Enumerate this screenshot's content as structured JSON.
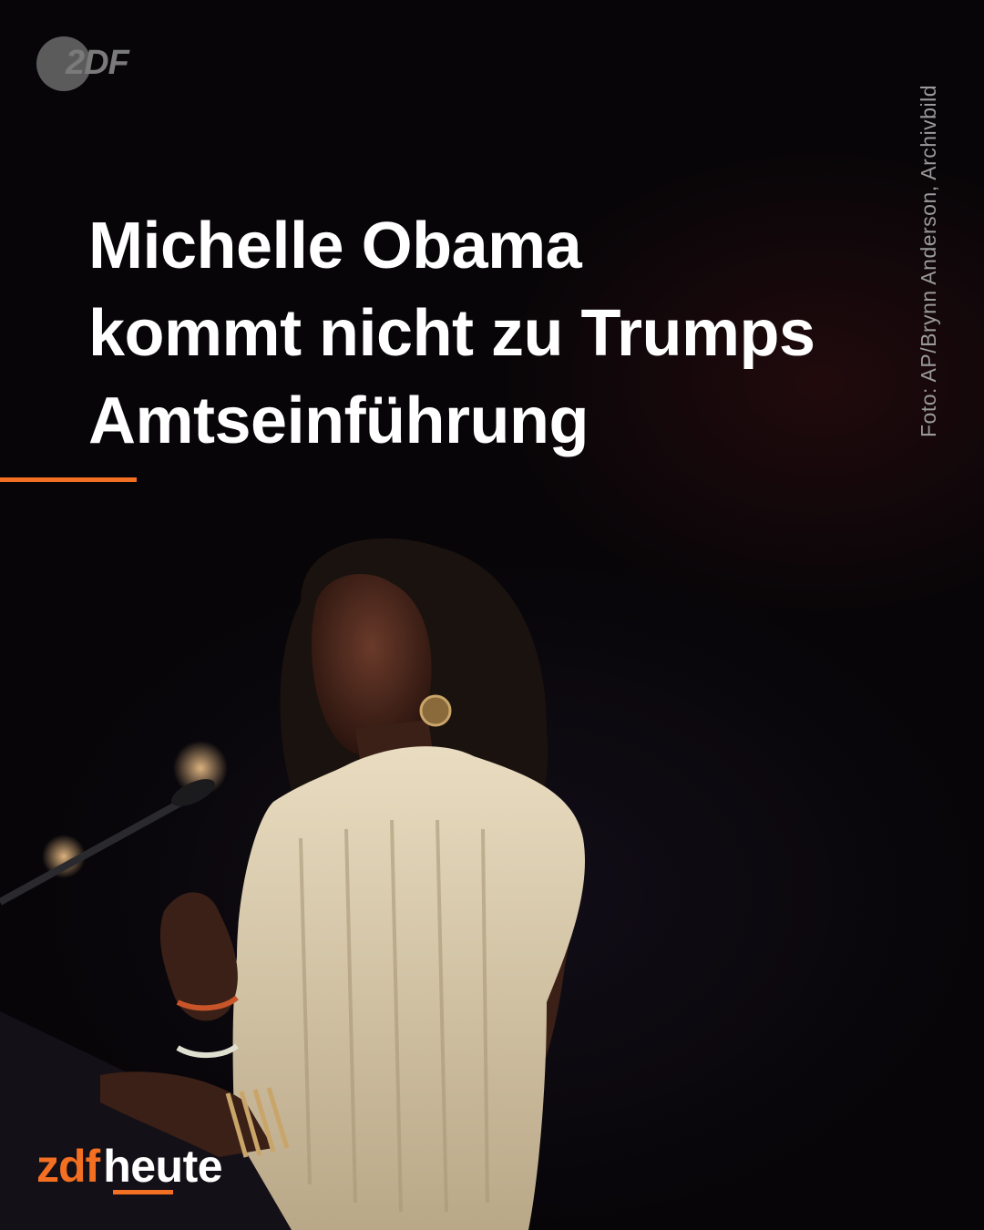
{
  "logo_top": {
    "text": "2DF"
  },
  "headline": {
    "lines": [
      "Michelle Obama",
      "kommt nicht zu Trumps",
      "Amtseinführung"
    ]
  },
  "photo_credit": "Foto: AP/Brynn Anderson, Archivbild",
  "brand": {
    "prefix": "zdf",
    "suffix": "heute"
  },
  "colors": {
    "accent": "#f36f21",
    "headline": "#ffffff",
    "background": "#070508"
  }
}
